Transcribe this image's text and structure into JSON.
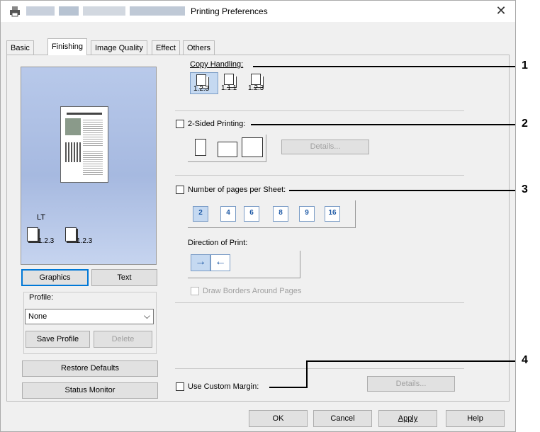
{
  "window": {
    "title": "Printing Preferences",
    "close_glyph": "✕"
  },
  "tabs": [
    "Basic",
    "Finishing",
    "Image Quality",
    "Effect",
    "Others"
  ],
  "active_tab": "Finishing",
  "preview": {
    "paper_label": "LT",
    "order_labels": [
      "1.2.3",
      "1.2.3"
    ]
  },
  "left_buttons": {
    "graphics": "Graphics",
    "text": "Text"
  },
  "profile": {
    "label": "Profile:",
    "selected": "None",
    "save": "Save Profile",
    "delete": "Delete"
  },
  "restore_defaults": "Restore Defaults",
  "status_monitor": "Status Monitor",
  "copy_handling": {
    "label": "Copy Handling:",
    "options": [
      "1.2.3",
      "1.1.1",
      "1.2.3"
    ]
  },
  "two_sided": {
    "label": "2-Sided Printing:",
    "details": "Details..."
  },
  "pages_per_sheet": {
    "label": "Number of pages per Sheet:",
    "options": [
      "2",
      "4",
      "6",
      "8",
      "9",
      "16"
    ]
  },
  "direction": {
    "label": "Direction of Print:",
    "options": [
      "→",
      "←"
    ]
  },
  "draw_borders": "Draw Borders Around Pages",
  "custom_margin": {
    "label": "Use Custom Margin:",
    "details": "Details..."
  },
  "footer": {
    "ok": "OK",
    "cancel": "Cancel",
    "apply": "Apply",
    "help": "Help"
  },
  "callouts": [
    "1",
    "2",
    "3",
    "4"
  ],
  "colors": {
    "accent": "#0078d7",
    "preview_bg": "#b8c9ea"
  }
}
